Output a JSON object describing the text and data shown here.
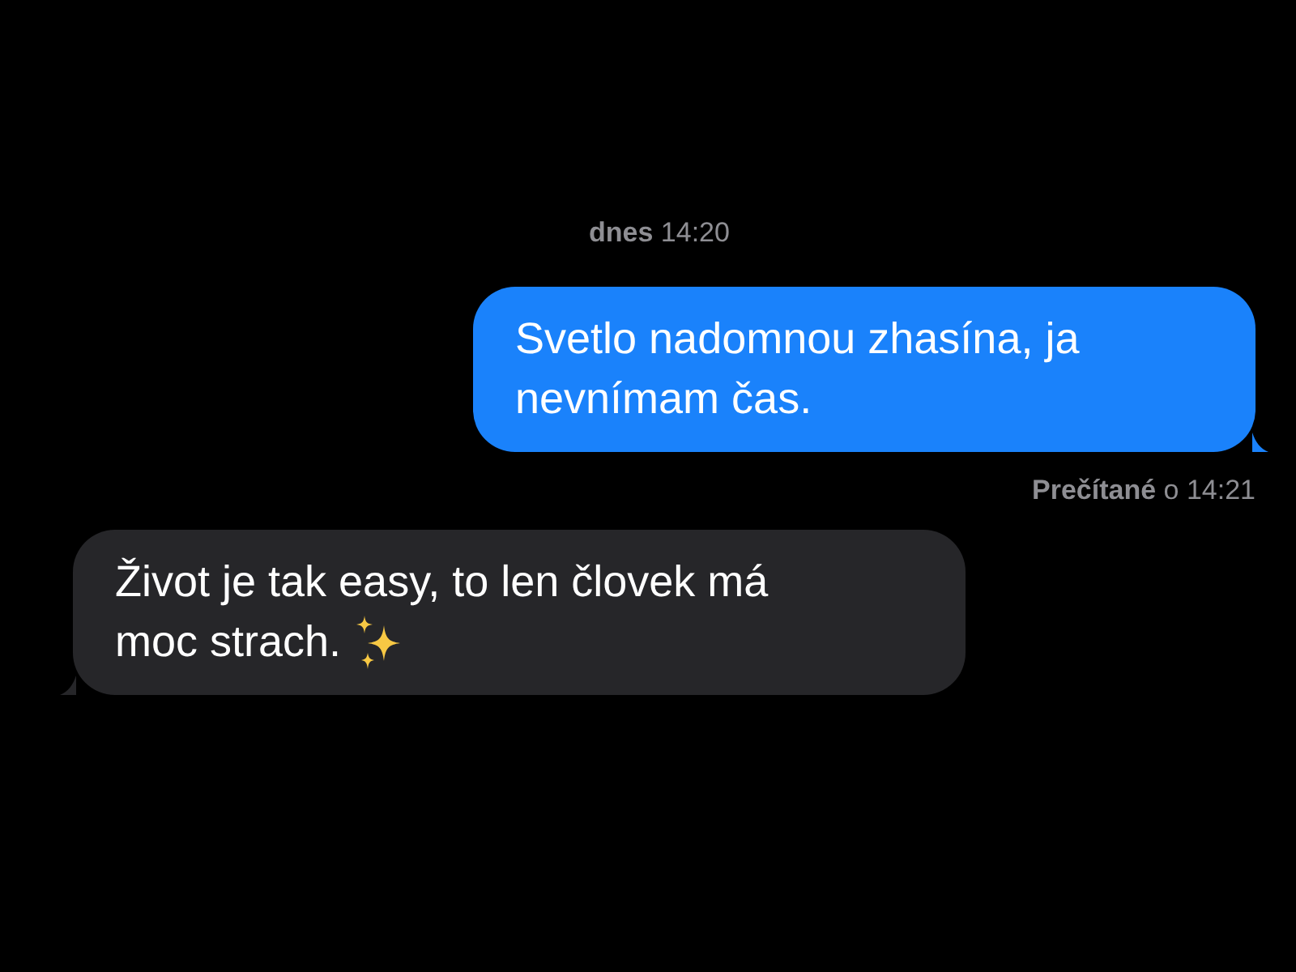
{
  "timestamp": "**dnes** 14:20",
  "messages": [
    {
      "kind": "sent",
      "lines": [
        "Svetlo nadomnou zhasína, ja",
        "nevnímam čas."
      ],
      "sparkles": false
    },
    {
      "kind": "received",
      "lines": [
        "Život je tak easy, to len človek má",
        "moc strach."
      ],
      "sparkles": true
    }
  ],
  "read_receipt": "**Prečítané** o 14:21"
}
